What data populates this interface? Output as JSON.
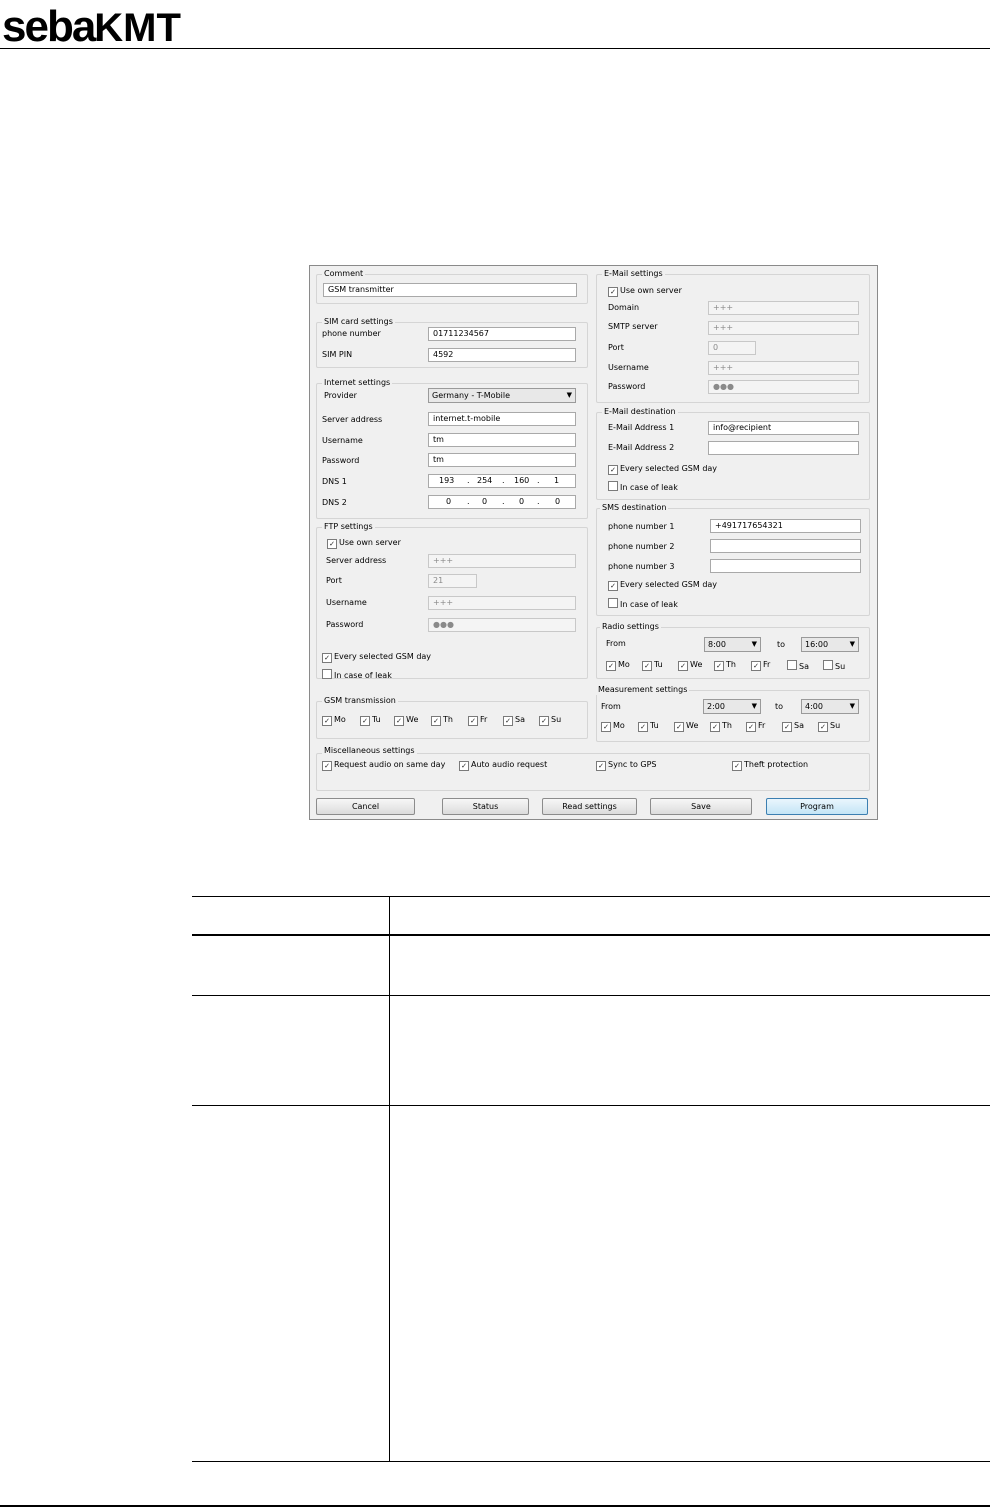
{
  "logo": {
    "part1": "seba",
    "part2": "KMT"
  },
  "comment": {
    "group": "Comment",
    "value": "GSM transmitter"
  },
  "sim": {
    "group": "SIM card settings",
    "phone_label": "phone number",
    "phone": "01711234567",
    "pin_label": "SIM PIN",
    "pin": "4592"
  },
  "internet": {
    "group": "Internet settings",
    "provider_label": "Provider",
    "provider": "Germany - T-Mobile",
    "server_label": "Server address",
    "server": "internet.t-mobile",
    "user_label": "Username",
    "user": "tm",
    "pass_label": "Password",
    "pass": "tm",
    "dns1_label": "DNS 1",
    "dns1": [
      "193",
      "254",
      "160",
      "1"
    ],
    "dns2_label": "DNS 2",
    "dns2": [
      "0",
      "0",
      "0",
      "0"
    ]
  },
  "ftp": {
    "group": "FTP settings",
    "own_server": "Use own server",
    "server_label": "Server address",
    "server": "+++",
    "port_label": "Port",
    "port": "21",
    "user_label": "Username",
    "user": "+++",
    "pass_label": "Password",
    "pass": "●●●",
    "every_day": "Every selected GSM day",
    "leak": "In case of leak"
  },
  "gsm": {
    "group": "GSM transmission",
    "days": [
      "Mo",
      "Tu",
      "We",
      "Th",
      "Fr",
      "Sa",
      "Su"
    ]
  },
  "email": {
    "group": "E-Mail settings",
    "own_server": "Use own server",
    "domain_label": "Domain",
    "domain": "+++",
    "smtp_label": "SMTP server",
    "smtp": "+++",
    "port_label": "Port",
    "port": "0",
    "user_label": "Username",
    "user": "+++",
    "pass_label": "Password",
    "pass": "●●●"
  },
  "email_dest": {
    "group": "E-Mail destination",
    "addr1_label": "E-Mail Address 1",
    "addr1": "info@recipient",
    "addr2_label": "E-Mail Address 2",
    "addr2": "",
    "every_day": "Every selected GSM day",
    "leak": "In case of leak"
  },
  "sms": {
    "group": "SMS destination",
    "p1_label": "phone number 1",
    "p1": "+491717654321",
    "p2_label": "phone number 2",
    "p2": "",
    "p3_label": "phone number 3",
    "p3": "",
    "every_day": "Every selected GSM day",
    "leak": "In case of leak"
  },
  "radio": {
    "group": "Radio settings",
    "from_label": "From",
    "from": "8:00",
    "to_label": "to",
    "to": "16:00",
    "days": [
      "Mo",
      "Tu",
      "We",
      "Th",
      "Fr",
      "Sa",
      "Su"
    ]
  },
  "measure": {
    "group": "Measurement settings",
    "from_label": "From",
    "from": "2:00",
    "to_label": "to",
    "to": "4:00",
    "days": [
      "Mo",
      "Tu",
      "We",
      "Th",
      "Fr",
      "Sa",
      "Su"
    ]
  },
  "misc": {
    "group": "Miscellaneous settings",
    "audio_same_day": "Request audio on same day",
    "auto_audio": "Auto audio request",
    "sync_gps": "Sync to GPS",
    "theft": "Theft protection"
  },
  "buttons": {
    "cancel": "Cancel",
    "status": "Status",
    "read": "Read settings",
    "save": "Save",
    "program": "Program"
  },
  "checkmark": "✓"
}
